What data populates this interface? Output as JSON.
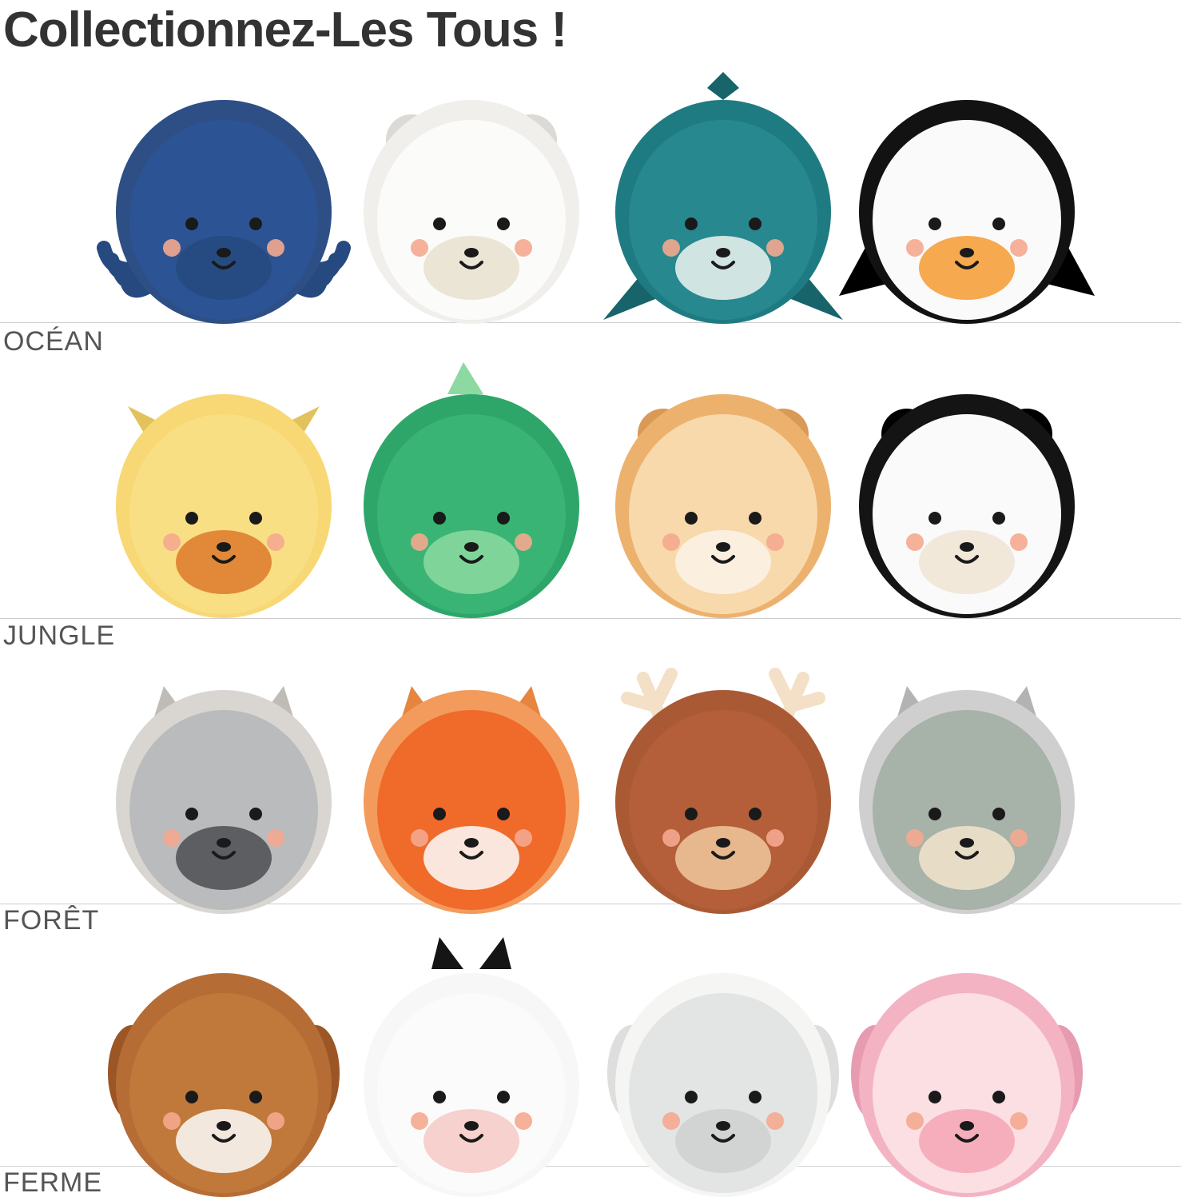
{
  "title": "Collectionnez-Les Tous !",
  "sections": [
    {
      "label": "OCÉAN",
      "items": [
        {
          "icon": "octopus-plush-icon",
          "body": "#2d4f86",
          "shade": "#23406f",
          "face": "#2c5494",
          "accent": "#264a80"
        },
        {
          "icon": "polar-bear-plush-icon",
          "body": "#f1efec",
          "shade": "#dcdad6",
          "face": "#fbfbfa",
          "accent": "#e8e0cf"
        },
        {
          "icon": "whale-plush-icon",
          "body": "#1f7b82",
          "shade": "#17646a",
          "face": "#27888f",
          "accent": "#eef4f1"
        },
        {
          "icon": "penguin-plush-icon",
          "body": "#121212",
          "shade": "#000000",
          "face": "#fafafa",
          "accent": "#f59a30"
        }
      ]
    },
    {
      "label": "JUNGLE",
      "items": [
        {
          "icon": "giraffe-plush-icon",
          "body": "#f7d875",
          "shade": "#e9943f",
          "face": "#f9df84",
          "accent": "#de7a2c"
        },
        {
          "icon": "dinosaur-plush-icon",
          "body": "#2ea66a",
          "shade": "#23864f",
          "face": "#39b474",
          "accent": "#8cd9a1"
        },
        {
          "icon": "lion-plush-icon",
          "body": "#edb16e",
          "shade": "#d99a57",
          "face": "#f8d9ab",
          "accent": "#fbf3e7"
        },
        {
          "icon": "panda-plush-icon",
          "body": "#141414",
          "shade": "#000000",
          "face": "#fafafa",
          "accent": "#efe4d3"
        }
      ]
    },
    {
      "label": "FORÊT",
      "items": [
        {
          "icon": "raccoon-plush-icon",
          "body": "#d9d6d2",
          "shade": "#bfbcb8",
          "face": "#b9bbbd",
          "accent": "#4b4d52"
        },
        {
          "icon": "fox-plush-icon",
          "body": "#f39b5c",
          "shade": "#e58540",
          "face": "#f06a2a",
          "accent": "#fbfbfb"
        },
        {
          "icon": "bear-plush-icon",
          "body": "#a95a35",
          "shade": "#8b4527",
          "face": "#b45f39",
          "accent": "#f0c89c"
        },
        {
          "icon": "owl-plush-icon",
          "body": "#cfcfcf",
          "shade": "#b3b3b3",
          "face": "#a7b2a9",
          "accent": "#f2e4cc"
        }
      ]
    },
    {
      "label": "FERME",
      "items": [
        {
          "icon": "dog-plush-icon",
          "body": "#b66d35",
          "shade": "#9c5626",
          "face": "#c0793a",
          "accent": "#fbfbfb"
        },
        {
          "icon": "cow-plush-icon",
          "body": "#f7f7f7",
          "shade": "#272727",
          "face": "#fbfbfb",
          "accent": "#f6c9c4"
        },
        {
          "icon": "sheep-plush-icon",
          "body": "#f5f5f3",
          "shade": "#dedede",
          "face": "#e3e4e4",
          "accent": "#cfd0d0"
        },
        {
          "icon": "pig-plush-icon",
          "body": "#f3b3c3",
          "shade": "#e79bb0",
          "face": "#fbdfe3",
          "accent": "#f5a6b6"
        }
      ]
    }
  ]
}
